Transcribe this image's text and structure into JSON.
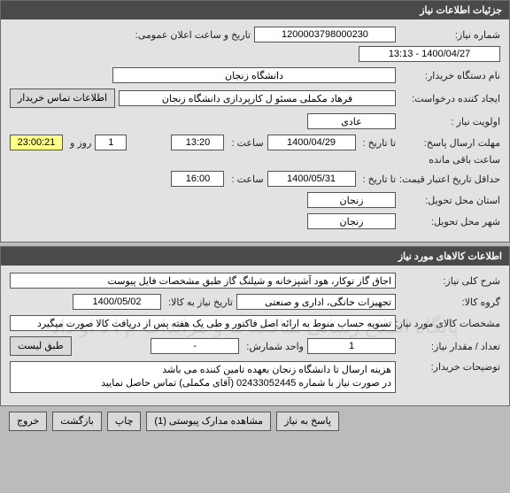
{
  "sections": {
    "top": {
      "title": "جزئیات اطلاعات نیاز"
    },
    "items": {
      "title": "اطلاعات کالاهای مورد نیاز"
    }
  },
  "top": {
    "need_no_label": "شماره نیاز:",
    "need_no": "1200003798000230",
    "announce_dt_label": "تاریخ و ساعت اعلان عمومی:",
    "announce_dt": "1400/04/27 - 13:13",
    "buyer_label": "نام دستگاه خریدار:",
    "buyer": "دانشگاه زنجان",
    "requester_label": "ایجاد کننده درخواست:",
    "requester": "فرهاد مکملی مسئو ل کارپردازی دانشگاه زنجان",
    "contact_btn": "اطلاعات تماس خریدار",
    "priority_label": "اولویت نیاز :",
    "priority": "عادی",
    "reply_deadline_label": "مهلت ارسال پاسخ:",
    "to_date_label": "تا تاریخ :",
    "reply_to_date": "1400/04/29",
    "time_label": "ساعت :",
    "reply_time": "13:20",
    "days": "1",
    "days_label": "روز و",
    "countdown": "23:00:21",
    "remaining_label": "ساعت باقی مانده",
    "validity_label": "حداقل تاریخ اعتبار قیمت:",
    "validity_to_date": "1400/05/31",
    "validity_time": "16:00",
    "province_label": "استان محل تحویل:",
    "province": "زنجان",
    "city_label": "شهر محل تحویل:",
    "city": "زنجان"
  },
  "items": {
    "desc_label": "شرح کلی نیاز:",
    "desc": "اجاق گاز توکار، هود آشپزخانه و شیلنگ گاز طبق مشخصات فایل پیوست",
    "group_label": "گروه کالا:",
    "group": "تجهیزات خانگی، اداری و صنعتی",
    "need_date_label": "تاریخ نیاز به کالا:",
    "need_date": "1400/05/02",
    "specs_label": "مشخصات کالای مورد نیاز:",
    "specs": "تسویه حساب منوط به ارائه اصل فاکتور و طی یک هفته پس از دریافت کالا صورت میگیرد",
    "qty_label": "تعداد / مقدار نیاز:",
    "qty": "1",
    "unit_label": "واحد شمارش:",
    "unit": "-",
    "list_btn": "طبق لیست",
    "notes_label": "توضیحات خریدار:",
    "notes": "هزینه ارسال تا دانشگاه زنجان بعهده تامین کننده می باشد\nدر صورت نیاز با شماره 02433052445 (آقای مکملی) تماس حاصل نمایید",
    "watermark": "پایگاه اطلاع رسانی مناقصات و مزایدات م ا د او داد"
  },
  "footer": {
    "reply": "پاسخ به نیاز",
    "attachments": "مشاهده مدارک پیوستی (1)",
    "print": "چاپ",
    "back": "بازگشت",
    "exit": "خروج"
  }
}
